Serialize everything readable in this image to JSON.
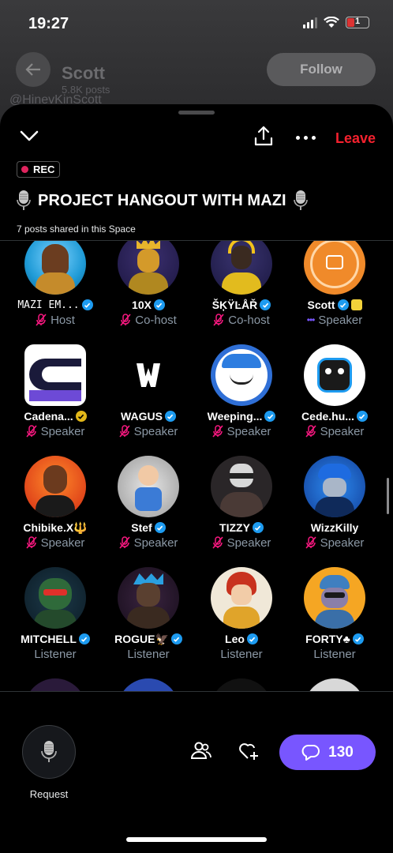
{
  "status_bar": {
    "time": "19:27",
    "battery": "1"
  },
  "profile": {
    "name": "Scott",
    "posts": "5.8K posts",
    "handle": "@HinevKinScott",
    "follow_label": "Follow"
  },
  "space": {
    "leave_label": "Leave",
    "rec_label": "REC",
    "title": "PROJECT HANGOUT WITH MAZI",
    "posts_shared": "7 posts shared in this Space"
  },
  "participants": [
    {
      "name": "MAZI EM...",
      "role": "Host",
      "verified": "blue"
    },
    {
      "name": "10X",
      "role": "Co-host",
      "verified": "blue"
    },
    {
      "name": "ŠĶŸĿÅŘ",
      "role": "Co-host",
      "verified": "blue"
    },
    {
      "name": "Scott",
      "role": "Speaker",
      "verified": "blue"
    },
    {
      "name": "Cadena...",
      "role": "Speaker",
      "verified": "gold"
    },
    {
      "name": "WAGUS",
      "role": "Speaker",
      "verified": "blue"
    },
    {
      "name": "Weeping...",
      "role": "Speaker",
      "verified": "blue"
    },
    {
      "name": "Cede.hu...",
      "role": "Speaker",
      "verified": "blue"
    },
    {
      "name": "Chibike.X🔱",
      "role": "Speaker",
      "verified": "none"
    },
    {
      "name": "Stef",
      "role": "Speaker",
      "verified": "blue"
    },
    {
      "name": "TIZZY",
      "role": "Speaker",
      "verified": "blue"
    },
    {
      "name": "WizzKilly",
      "role": "Speaker",
      "verified": "none"
    },
    {
      "name": "MITCHELL",
      "role": "Listener",
      "verified": "blue"
    },
    {
      "name": "ROGUE🦅",
      "role": "Listener",
      "verified": "blue"
    },
    {
      "name": "Leo",
      "role": "Listener",
      "verified": "blue"
    },
    {
      "name": "FORTY♣",
      "role": "Listener",
      "verified": "blue"
    }
  ],
  "bottom_bar": {
    "request_label": "Request",
    "comment_count": "130"
  },
  "colors": {
    "accent": "#7856ff",
    "leave": "#f4212e",
    "verified": "#1d9bf0",
    "muted_mic": "#f91880"
  }
}
